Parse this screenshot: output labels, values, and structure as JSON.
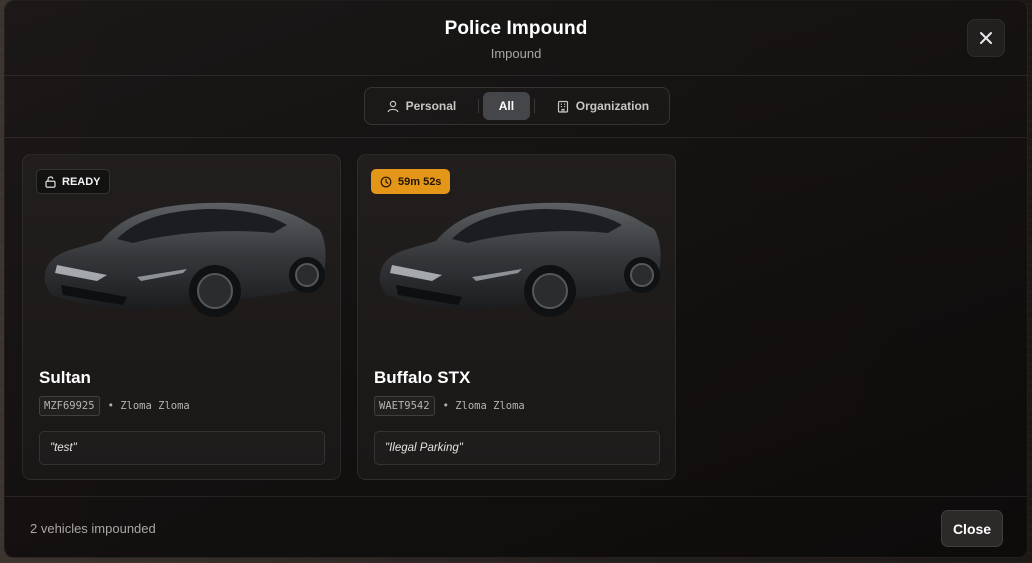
{
  "header": {
    "title": "Police Impound",
    "subtitle": "Impound"
  },
  "filters": {
    "tabs": [
      {
        "label": "Personal",
        "icon": "user-icon",
        "active": false
      },
      {
        "label": "All",
        "icon": "",
        "active": true
      },
      {
        "label": "Organization",
        "icon": "building-icon",
        "active": false
      }
    ]
  },
  "vehicles": [
    {
      "status_label": "READY",
      "status_icon": "unlock-icon",
      "status_color": "#111111",
      "name": "Sultan",
      "plate": "MZF69925",
      "owner": "• Zloma Zloma",
      "note": "\"test\""
    },
    {
      "status_label": "59m 52s",
      "status_icon": "clock-icon",
      "status_color": "#e39618",
      "name": "Buffalo STX",
      "plate": "WAET9542",
      "owner": "• Zloma Zloma",
      "note": "\"Ilegal Parking\""
    }
  ],
  "footer": {
    "count_text": "2 vehicles impounded",
    "close_label": "Close"
  }
}
